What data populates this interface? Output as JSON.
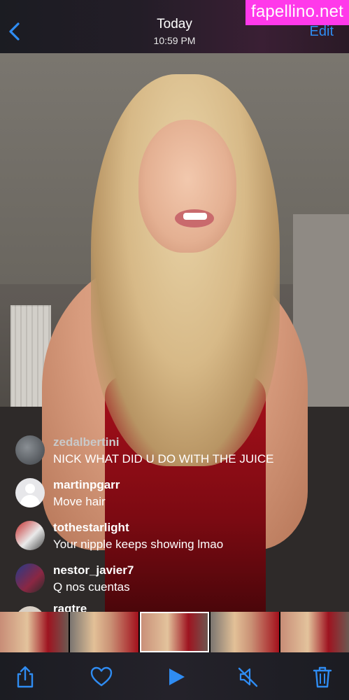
{
  "nav": {
    "title": "Today",
    "time": "10:59 PM",
    "edit_label": "Edit"
  },
  "watermark": "fapellino.net",
  "comments": [
    {
      "username": "zedalbertini",
      "text": "NICK WHAT DID U DO WITH THE JUICE",
      "avatar": "photo"
    },
    {
      "username": "martinpgarr",
      "text": "Move hair",
      "avatar": "default-person"
    },
    {
      "username": "tothestarlight",
      "text": "Your nipple keeps showing lmao",
      "avatar": "photo"
    },
    {
      "username": "nestor_javier7",
      "text": "Q nos cuentas",
      "avatar": "photo"
    },
    {
      "username": "ragtre",
      "text": "",
      "avatar": "photo"
    }
  ],
  "toolbar": {
    "icons": [
      "share-icon",
      "heart-icon",
      "play-icon",
      "speaker-muted-icon",
      "trash-icon"
    ],
    "accent": "#2f8cf2"
  }
}
